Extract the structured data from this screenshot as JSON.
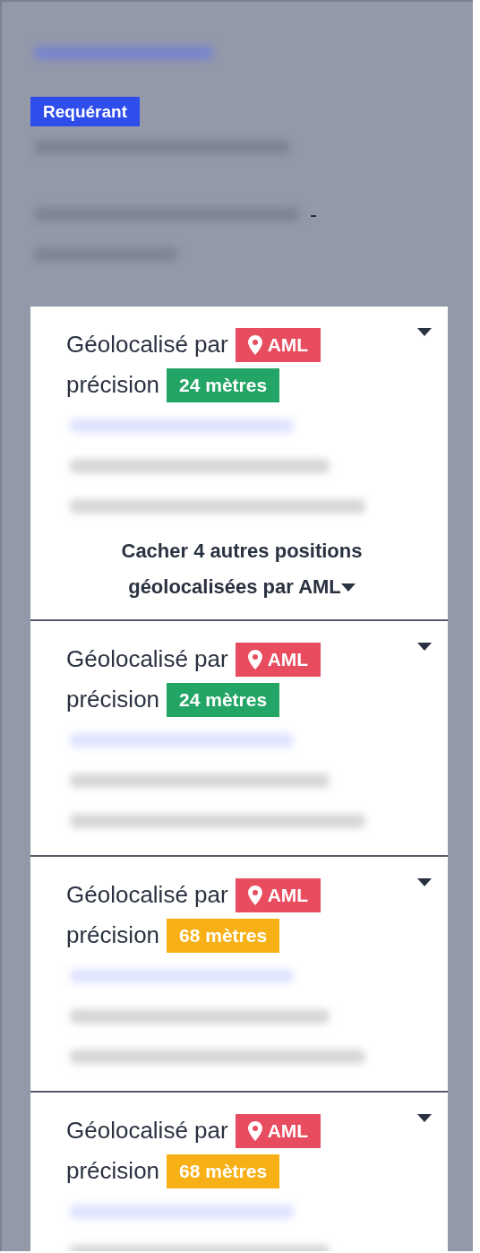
{
  "requester": {
    "badge": "Requérant",
    "address_suffix": "-"
  },
  "positions": [
    {
      "source_label": "Géolocalisé par",
      "source_badge": "AML",
      "precision_label": "précision",
      "precision_badge": "24 mètres",
      "color": "#22a565",
      "redacted_lines": [
        {
          "kind": "link"
        },
        {
          "kind": "text"
        },
        {
          "kind": "text"
        }
      ],
      "toggle": {
        "label": "Cacher 4 autres positions géolocalisées par AML",
        "expanded": true
      }
    },
    {
      "source_label": "Géolocalisé par",
      "source_badge": "AML",
      "precision_label": "précision",
      "precision_badge": "24 mètres",
      "color": "#22a565",
      "redacted_lines": [
        {
          "kind": "link"
        },
        {
          "kind": "text"
        },
        {
          "kind": "text"
        }
      ]
    },
    {
      "source_label": "Géolocalisé par",
      "source_badge": "AML",
      "precision_label": "précision",
      "precision_badge": "68 mètres",
      "color": "#f8b017",
      "redacted_lines": [
        {
          "kind": "link"
        },
        {
          "kind": "text"
        },
        {
          "kind": "text"
        }
      ]
    },
    {
      "source_label": "Géolocalisé par",
      "source_badge": "AML",
      "precision_label": "précision",
      "precision_badge": "68 mètres",
      "color": "#f8b017",
      "redacted_lines": [
        {
          "kind": "link"
        },
        {
          "kind": "text"
        }
      ]
    }
  ]
}
